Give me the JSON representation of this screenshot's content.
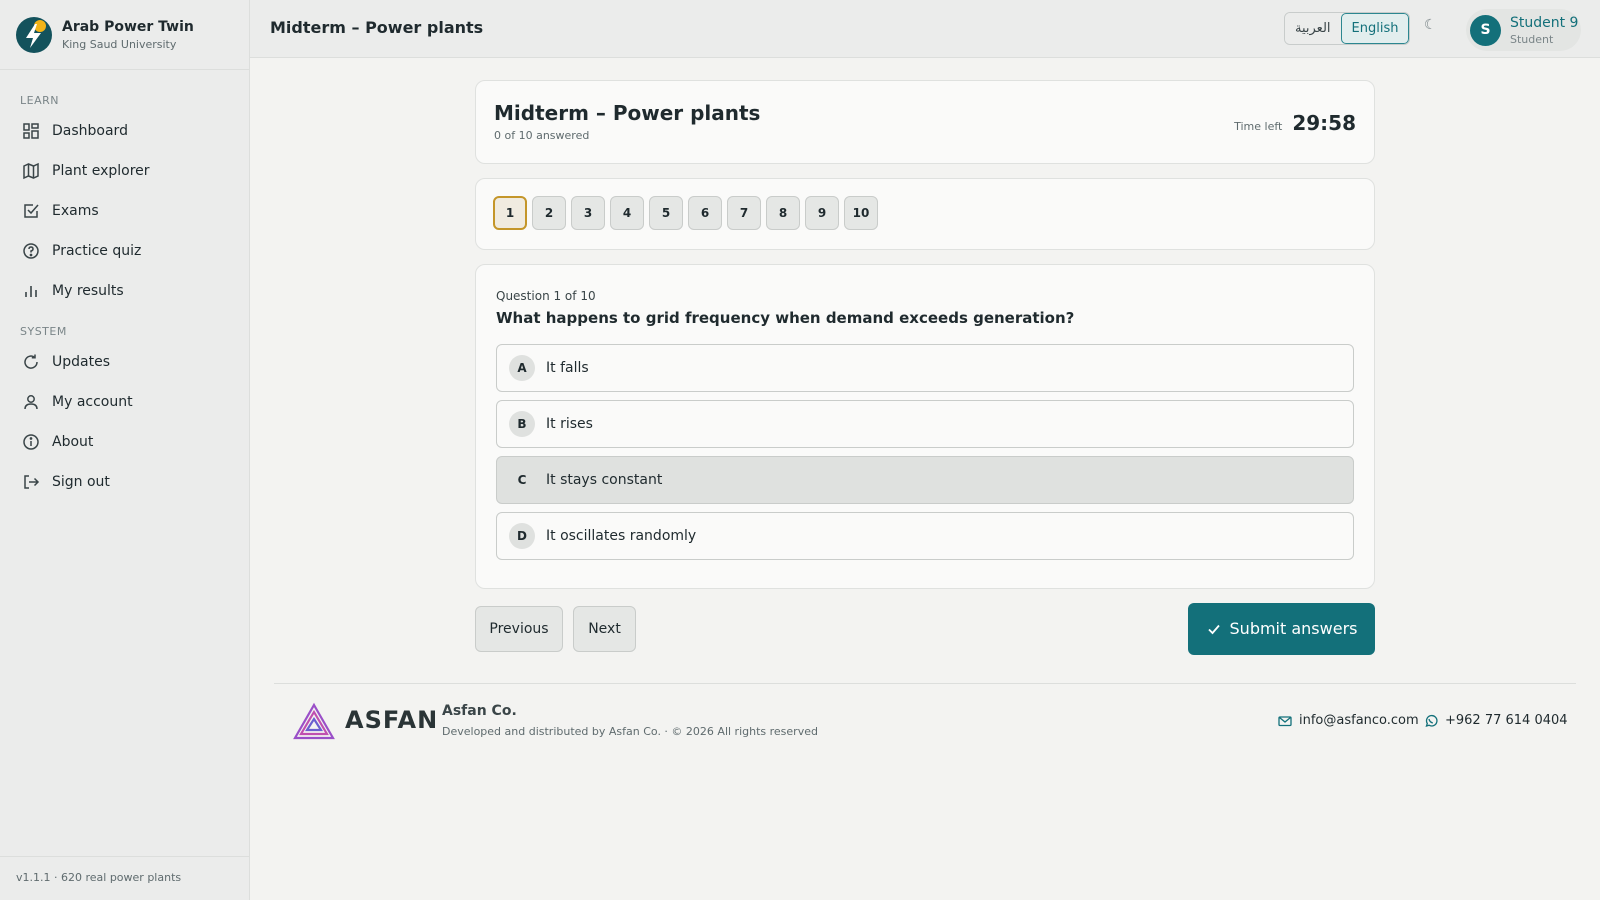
{
  "brand": {
    "title": "Arab Power Twin",
    "subtitle": "King Saud University"
  },
  "sidebar": {
    "learn_label": "LEARN",
    "learn_items": [
      {
        "label": "Dashboard",
        "icon": "dashboard-icon"
      },
      {
        "label": "Plant explorer",
        "icon": "map-icon"
      },
      {
        "label": "Exams",
        "icon": "checkbox-icon"
      },
      {
        "label": "Practice quiz",
        "icon": "help-circle-icon"
      },
      {
        "label": "My results",
        "icon": "bar-chart-icon"
      }
    ],
    "system_label": "SYSTEM",
    "system_items": [
      {
        "label": "Updates",
        "icon": "refresh-icon"
      },
      {
        "label": "My account",
        "icon": "user-icon"
      },
      {
        "label": "About",
        "icon": "info-icon"
      },
      {
        "label": "Sign out",
        "icon": "sign-out-icon"
      }
    ],
    "version": "v1.1.1 · 620 real power plants"
  },
  "header": {
    "title": "Midterm – Power plants",
    "lang_arabic": "العربية",
    "lang_english": "English",
    "theme_icon": "☾",
    "user_initial": "S",
    "user_name": "Student 9",
    "user_role": "Student"
  },
  "exam": {
    "title": "Midterm – Power plants",
    "progress": "0 of 10 answered",
    "time_label": "Time left",
    "time_value": "29:58",
    "question_numbers": [
      "1",
      "2",
      "3",
      "4",
      "5",
      "6",
      "7",
      "8",
      "9",
      "10"
    ],
    "current_question": 1
  },
  "question": {
    "counter": "Question 1 of 10",
    "text": "What happens to grid frequency when demand exceeds generation?",
    "options": [
      {
        "letter": "A",
        "text": "It falls"
      },
      {
        "letter": "B",
        "text": "It rises"
      },
      {
        "letter": "C",
        "text": "It stays constant"
      },
      {
        "letter": "D",
        "text": "It oscillates randomly"
      }
    ],
    "highlighted_option": "C"
  },
  "actions": {
    "previous": "Previous",
    "next": "Next",
    "submit": "Submit answers"
  },
  "footer": {
    "logo_word": "ASFAN",
    "company": "Asfan Co.",
    "copyright": "Developed and distributed by Asfan Co. · © 2026 All rights reserved",
    "email": "info@asfanco.com",
    "phone": "+962 77 614 0404"
  },
  "colors": {
    "accent": "#13707a",
    "current_outline": "#c4962a",
    "sun": "#f2b418"
  }
}
